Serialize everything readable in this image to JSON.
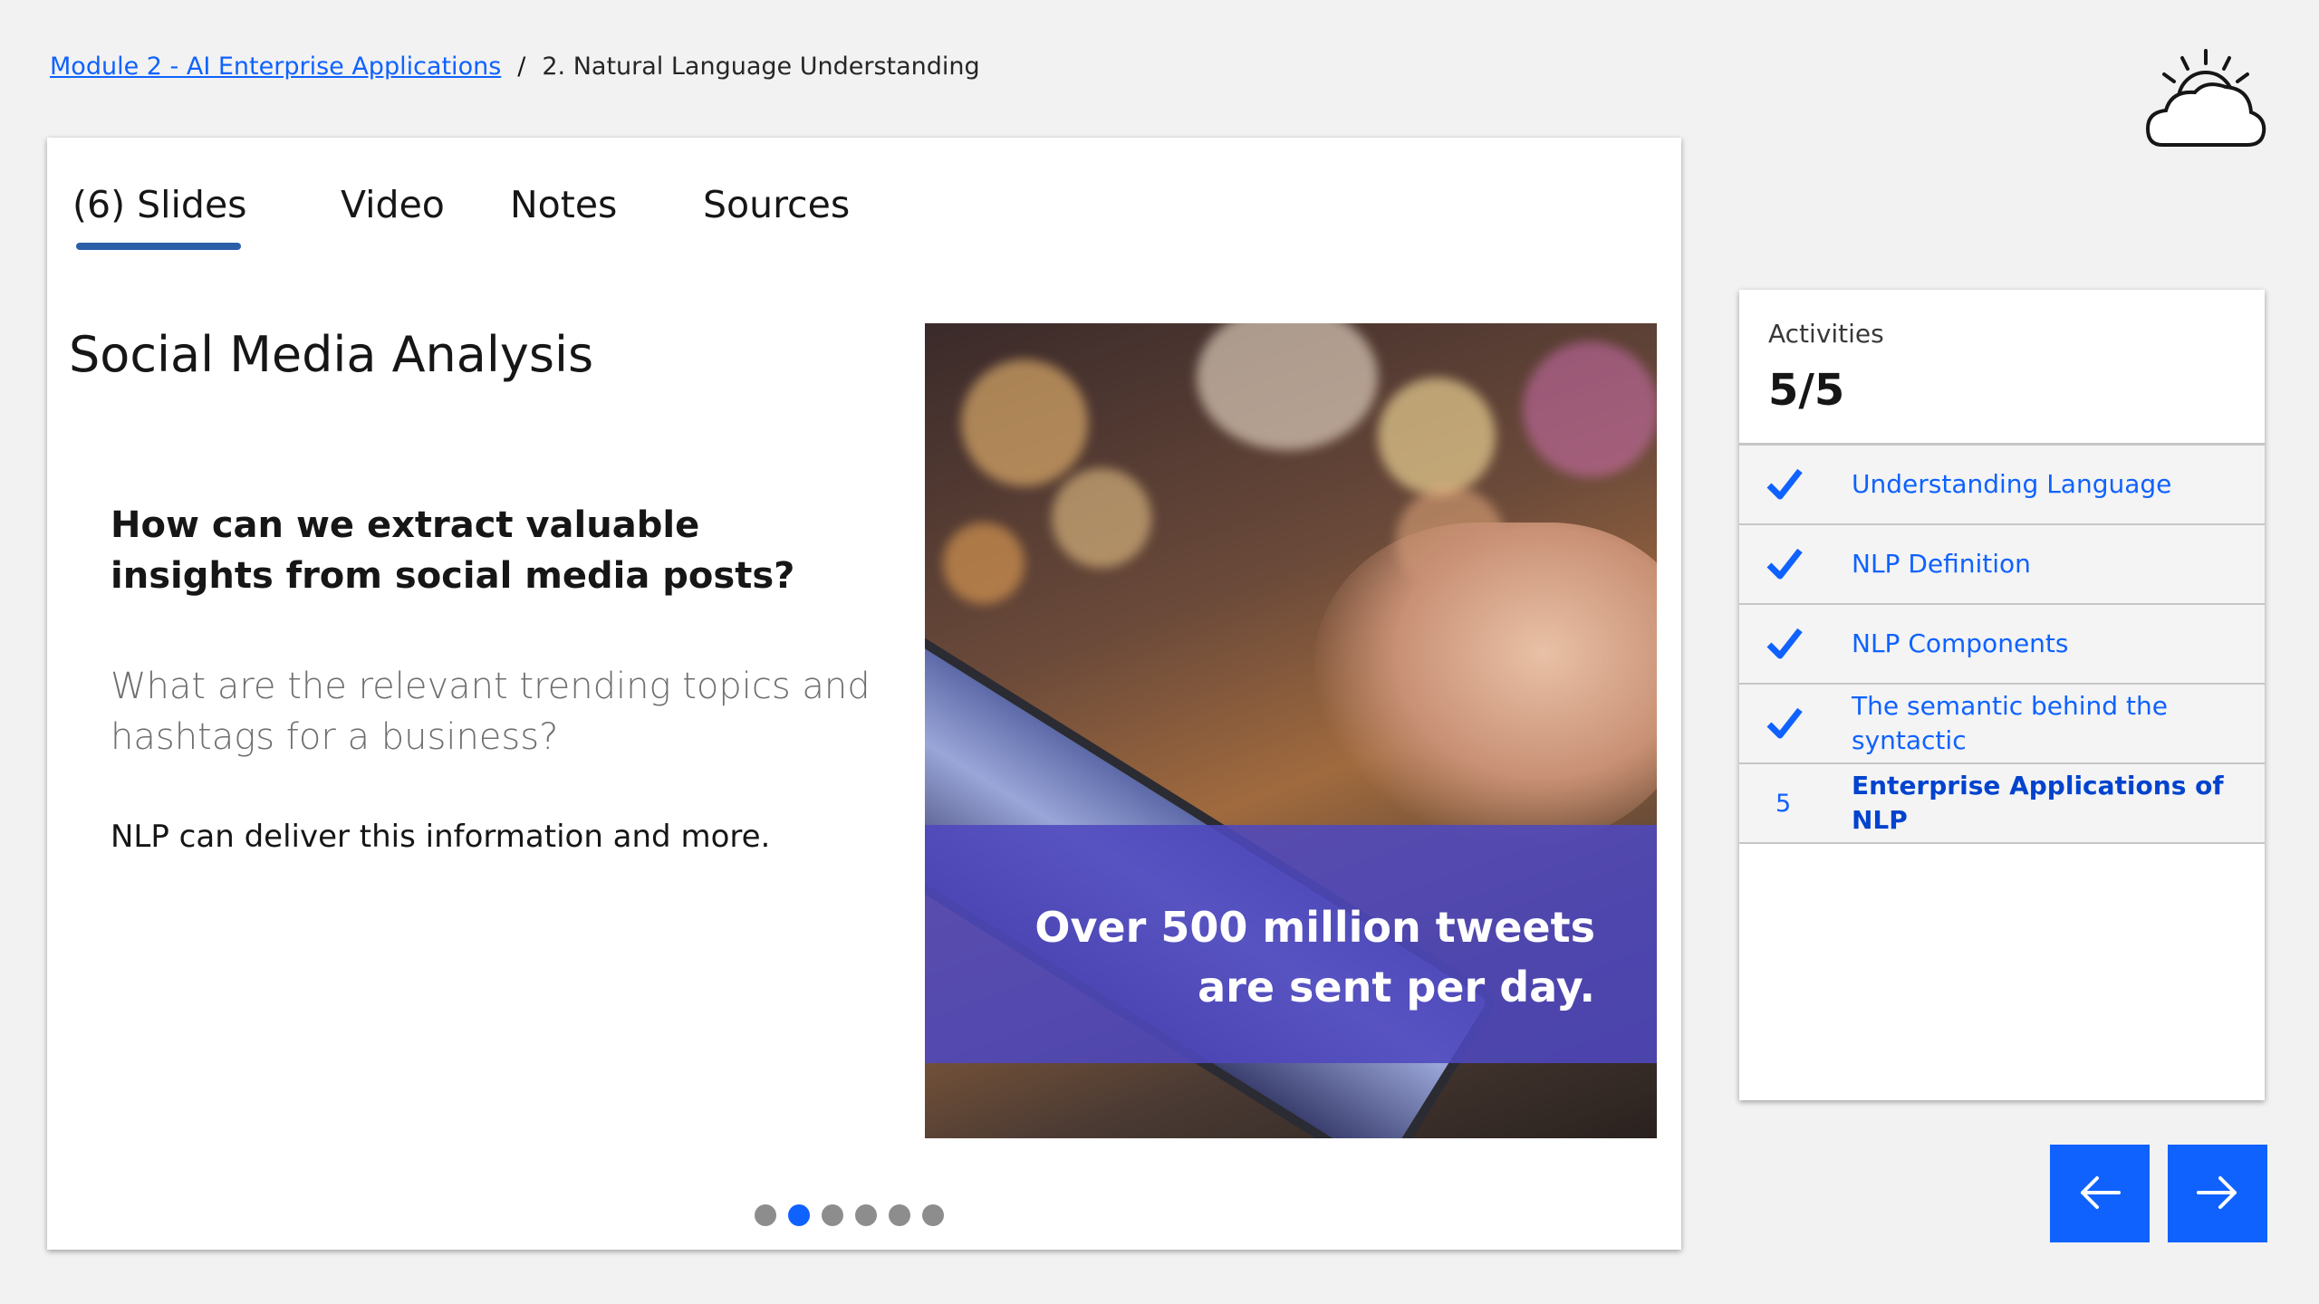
{
  "breadcrumb": {
    "parent_link": "Module 2 - AI Enterprise Applications",
    "separator": "/",
    "current": "2. Natural Language Understanding"
  },
  "tabs": [
    {
      "label": "(6) Slides",
      "active": true
    },
    {
      "label": "Video"
    },
    {
      "label": "Notes"
    },
    {
      "label": "Sources"
    }
  ],
  "slide": {
    "title": "Social Media Analysis",
    "question": "How can we extract valuable insights from social media posts?",
    "subquestion": "What are the relevant trending topics and hashtags for a business?",
    "statement": "NLP can deliver this information and more.",
    "image_caption": "Over 500 million tweets are sent per day.",
    "image_icon": "hand-holding-phone-photo"
  },
  "pagination": {
    "total": 6,
    "current": 2
  },
  "activities": {
    "label": "Activities",
    "count": "5/5",
    "items": [
      {
        "label": "Understanding Language",
        "status": "done"
      },
      {
        "label": "NLP Definition",
        "status": "done"
      },
      {
        "label": "NLP Components",
        "status": "done"
      },
      {
        "label": "The semantic behind the syntactic",
        "status": "done"
      },
      {
        "label": "Enterprise Applications of NLP",
        "status": "current",
        "number": "5"
      }
    ]
  },
  "nav": {
    "prev_icon": "arrow-left-icon",
    "next_icon": "arrow-right-icon"
  },
  "colors": {
    "accent": "#0f62fe",
    "tab_underline": "#2c5ea8",
    "overlay": "#4e48be",
    "background": "#f2f2f2"
  }
}
